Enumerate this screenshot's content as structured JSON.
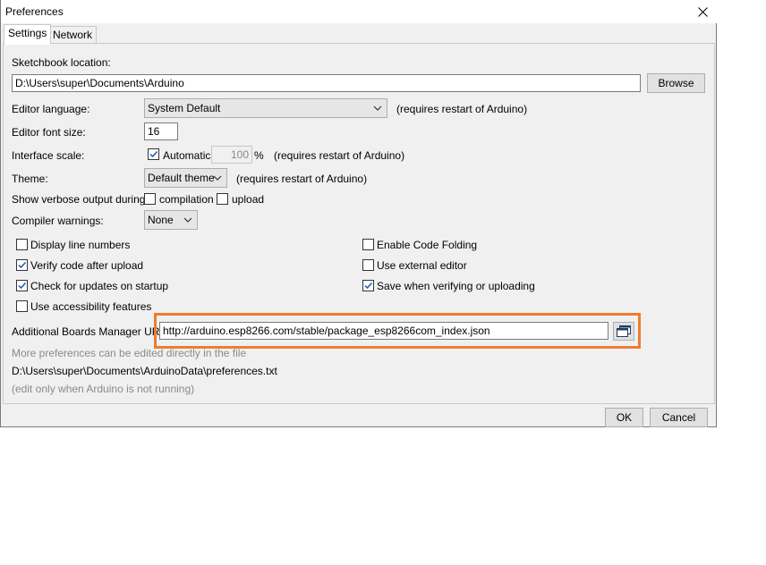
{
  "window": {
    "title": "Preferences"
  },
  "tabs": [
    {
      "label": "Settings"
    },
    {
      "label": "Network"
    }
  ],
  "sketchbook": {
    "label": "Sketchbook location:",
    "value": "D:\\Users\\super\\Documents\\Arduino",
    "browse_label": "Browse"
  },
  "editor_language": {
    "label": "Editor language:",
    "value": "System Default",
    "note": "(requires restart of Arduino)"
  },
  "font_size": {
    "label": "Editor font size:",
    "value": "16"
  },
  "interface_scale": {
    "label": "Interface scale:",
    "automatic_label": "Automatic",
    "automatic_checked": true,
    "value": "100",
    "unit": "%",
    "note": "(requires restart of Arduino)"
  },
  "theme": {
    "label": "Theme:",
    "value": "Default theme",
    "note": "(requires restart of Arduino)"
  },
  "verbose": {
    "label": "Show verbose output during:",
    "compilation_label": "compilation",
    "compilation_checked": false,
    "upload_label": "upload",
    "upload_checked": false
  },
  "compiler_warnings": {
    "label": "Compiler warnings:",
    "value": "None"
  },
  "options": {
    "display_line_numbers": {
      "label": "Display line numbers",
      "checked": false
    },
    "verify_after_upload": {
      "label": "Verify code after upload",
      "checked": true
    },
    "check_updates": {
      "label": "Check for updates on startup",
      "checked": true
    },
    "accessibility": {
      "label": "Use accessibility features",
      "checked": false
    },
    "code_folding": {
      "label": "Enable Code Folding",
      "checked": false
    },
    "external_editor": {
      "label": "Use external editor",
      "checked": false
    },
    "save_on_verify": {
      "label": "Save when verifying or uploading",
      "checked": true
    }
  },
  "boards_manager": {
    "label": "Additional Boards Manager URLs:",
    "value": "http://arduino.esp8266.com/stable/package_esp8266com_index.json"
  },
  "footer": {
    "more_prefs": "More preferences can be edited directly in the file",
    "prefs_path": "D:\\Users\\super\\Documents\\ArduinoData\\preferences.txt",
    "edit_note": "(edit only when Arduino is not running)"
  },
  "buttons": {
    "ok_label": "OK",
    "cancel_label": "Cancel"
  },
  "colors": {
    "highlight": "#ed7d31",
    "check": "#1e5aa8"
  },
  "icons": {
    "close": "close-icon",
    "chevron": "chevron-down-icon",
    "checkmark": "checkmark-icon",
    "url_editor": "window-icon"
  }
}
